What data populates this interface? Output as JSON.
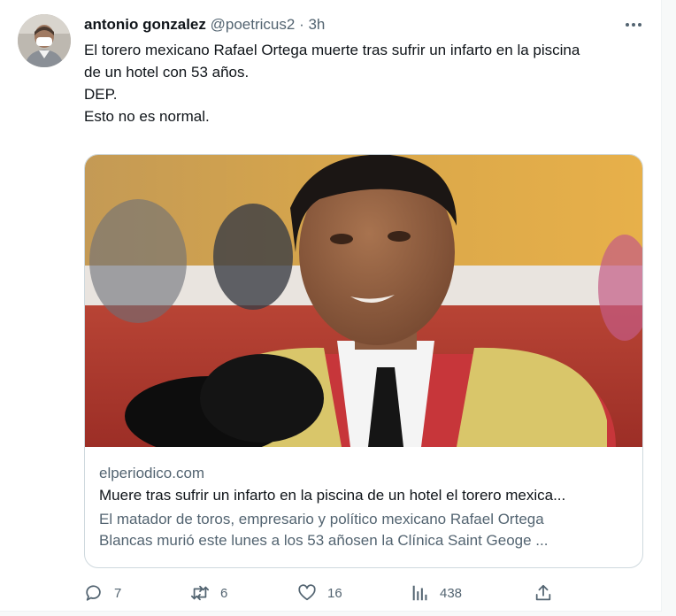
{
  "tweet": {
    "display_name": "antonio gonzalez",
    "handle": "@poetricus2",
    "separator": "·",
    "time": "3h",
    "text_lines": [
      "El torero mexicano Rafael Ortega muerte tras sufrir un infarto en la piscina",
      "de un hotel con 53 años.",
      "DEP.",
      "Esto no es normal."
    ]
  },
  "card": {
    "domain": "elperiodico.com",
    "title": "Muere tras sufrir un infarto en la piscina de un hotel el torero mexica...",
    "description_lines": [
      "El matador de toros, empresario y político mexicano Rafael Ortega",
      "Blancas murió este lunes a los 53 añosen la Clínica Saint Geoge ..."
    ]
  },
  "actions": {
    "replies": "7",
    "retweets": "6",
    "likes": "16",
    "views": "438"
  },
  "icons": {
    "reply": "reply-icon",
    "retweet": "retweet-icon",
    "like": "heart-icon",
    "views": "analytics-icon",
    "share": "share-icon",
    "more": "more-icon"
  },
  "colors": {
    "text": "#0f1419",
    "secondary": "#536471",
    "border": "#cfd9de"
  }
}
